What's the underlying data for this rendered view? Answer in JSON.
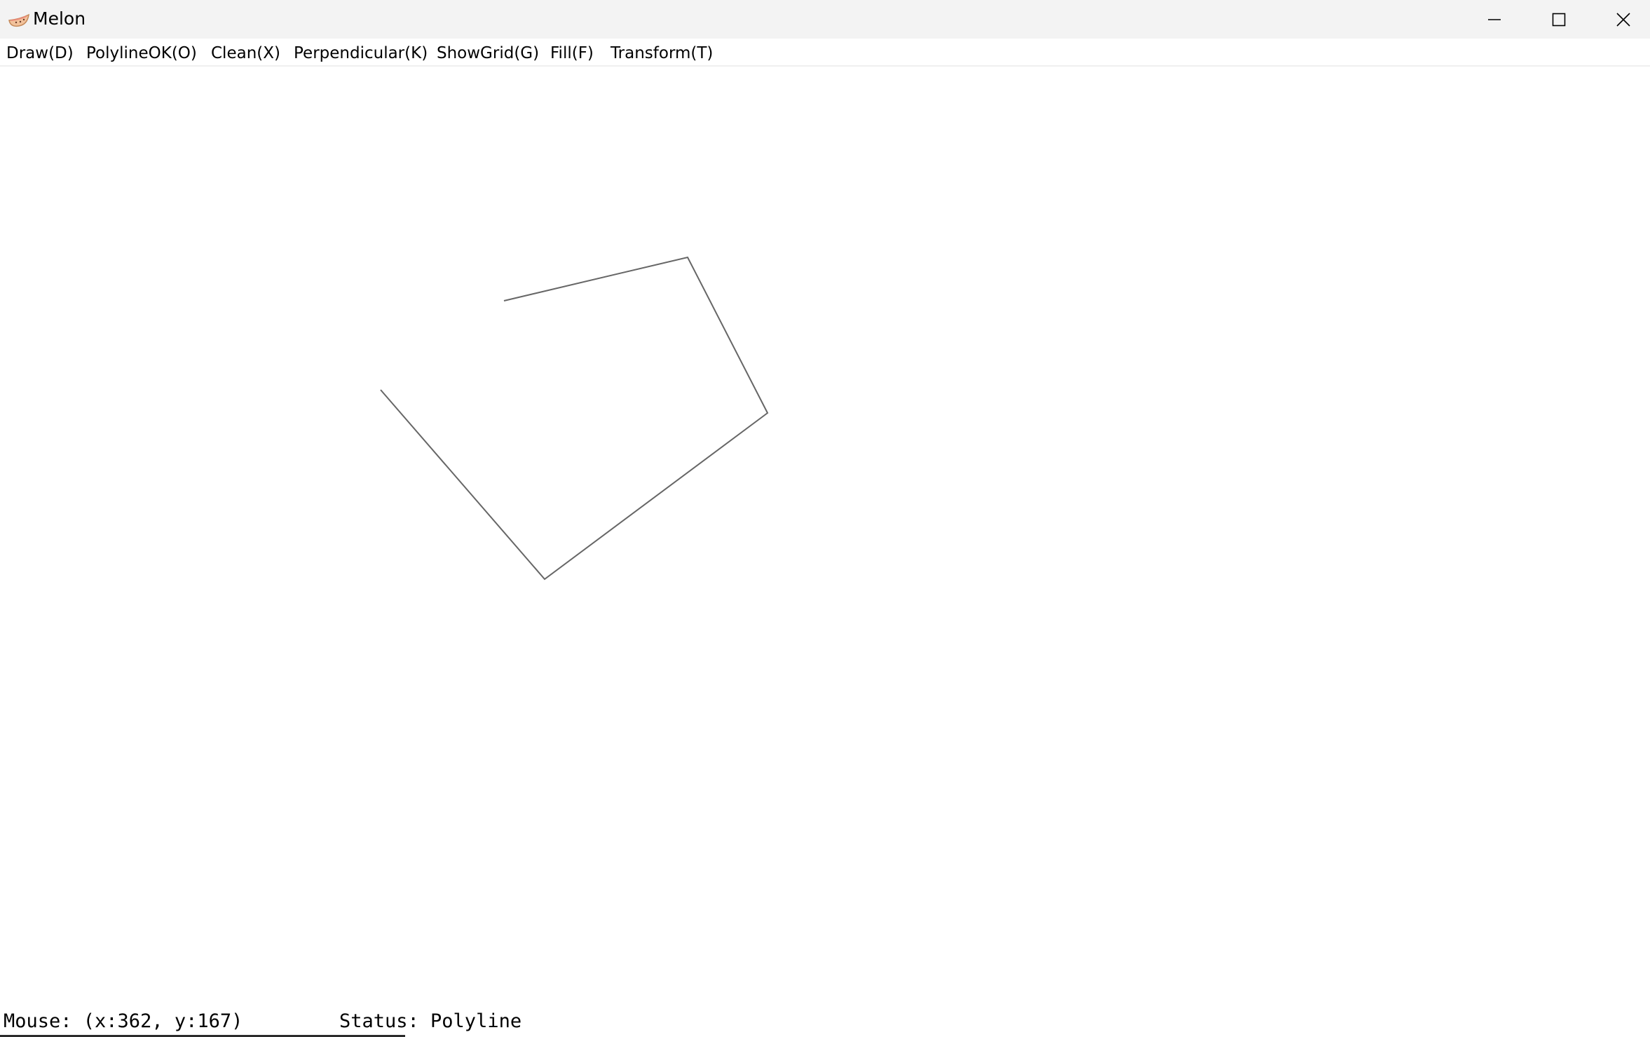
{
  "window": {
    "title": "Melon",
    "controls": [
      "minimize",
      "maximize",
      "close"
    ]
  },
  "menu": {
    "items": [
      {
        "label": "Draw(D)"
      },
      {
        "label": "PolylineOK(O)"
      },
      {
        "label": "Clean(X)"
      },
      {
        "label": "Perpendicular(K)"
      },
      {
        "label": "ShowGrid(G)"
      },
      {
        "label": "Fill(F)"
      },
      {
        "label": "Transform(T)"
      }
    ]
  },
  "canvas": {
    "shape": "polyline",
    "stroke_color": "#666666"
  },
  "status": {
    "mouse": "Mouse: (x:362, y:167)",
    "state": "Status: Polyline"
  },
  "colors": {
    "titlebar_bg": "#f3f3f3",
    "menubar_border": "#f0f0f0",
    "background": "#ffffff"
  }
}
